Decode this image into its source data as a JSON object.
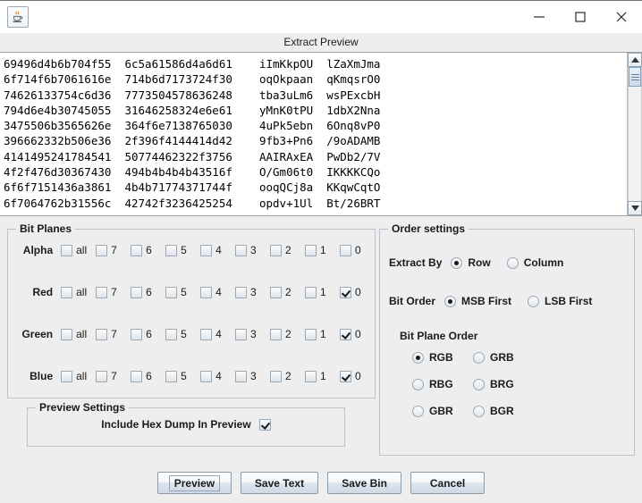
{
  "window": {
    "app_icon": "java-coffee-cup-icon",
    "minimize_label": "minimize-icon",
    "maximize_label": "maximize-icon",
    "close_label": "close-icon"
  },
  "header": {
    "title": "Extract Preview"
  },
  "preview": {
    "rows": [
      "69496d4b6b704f55  6c5a61586d4a6d61    iImKkpOU  lZaXmJma",
      "6f714f6b7061616e  714b6d7173724f30    oqOkpaan  qKmqsrO0",
      "74626133754c6d36  7773504578636248    tba3uLm6  wsPExcbH",
      "794d6e4b30745055  31646258324e6e61    yMnK0tPU  1dbX2Nna",
      "3475506b3565626e  364f6e7138765030    4uPk5ebn  6Onq8vP0",
      "396662332b506e36  2f396f4144414d42    9fb3+Pn6  /9oADAMB",
      "4141495241784541  50774462322f3756    AAIRAxEA  PwDb2/7V",
      "4f2f476d30367430  494b4b4b4b43516f    O/Gm06t0  IKKKKCQo",
      "6f6f7151436a3861  4b4b71774371744f    ooqQCj8a  KKqwCqtO",
      "6f7064762b31556c  42742f3236425254    opdv+1Ul  Bt/26BRT"
    ],
    "scrollbar": {
      "up_arrow": "scroll-up-icon",
      "down_arrow": "scroll-down-icon"
    }
  },
  "bit_planes": {
    "title": "Bit Planes",
    "columns": [
      "all",
      "7",
      "6",
      "5",
      "4",
      "3",
      "2",
      "1",
      "0"
    ],
    "rows": [
      {
        "label": "Alpha",
        "checked": [
          false,
          false,
          false,
          false,
          false,
          false,
          false,
          false,
          false
        ]
      },
      {
        "label": "Red",
        "checked": [
          false,
          false,
          false,
          false,
          false,
          false,
          false,
          false,
          true
        ]
      },
      {
        "label": "Green",
        "checked": [
          false,
          false,
          false,
          false,
          false,
          false,
          false,
          false,
          true
        ]
      },
      {
        "label": "Blue",
        "checked": [
          false,
          false,
          false,
          false,
          false,
          false,
          false,
          false,
          true
        ]
      }
    ]
  },
  "order_settings": {
    "title": "Order settings",
    "extract_by": {
      "label": "Extract By",
      "options": [
        "Row",
        "Column"
      ],
      "selected": "Row"
    },
    "bit_order": {
      "label": "Bit Order",
      "options": [
        "MSB First",
        "LSB First"
      ],
      "selected": "MSB First"
    },
    "bit_plane_order": {
      "label": "Bit Plane Order",
      "options": [
        "RGB",
        "GRB",
        "RBG",
        "BRG",
        "GBR",
        "BGR"
      ],
      "selected": "RGB"
    }
  },
  "preview_settings": {
    "title": "Preview Settings",
    "include_hex_dump": {
      "label": "Include Hex Dump In Preview",
      "checked": true
    }
  },
  "buttons": [
    {
      "label": "Preview",
      "focused": true
    },
    {
      "label": "Save Text",
      "focused": false
    },
    {
      "label": "Save Bin",
      "focused": false
    },
    {
      "label": "Cancel",
      "focused": false
    }
  ]
}
